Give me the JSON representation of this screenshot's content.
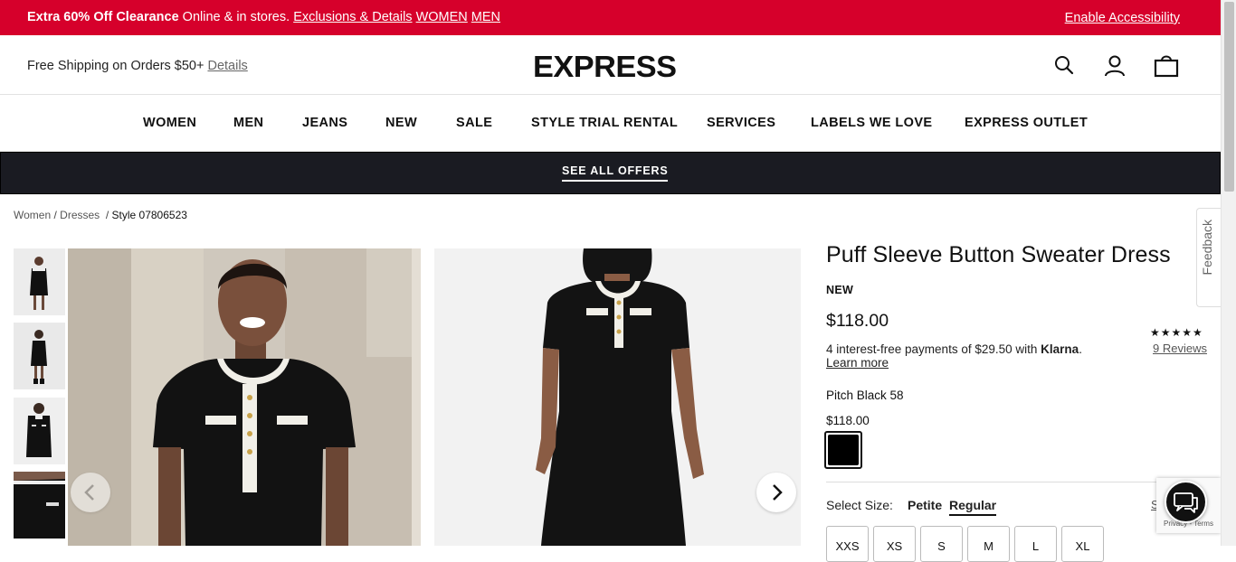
{
  "promo": {
    "bold": "Extra 60% Off Clearance",
    "text": "Online & in stores.",
    "links": [
      "Exclusions & Details",
      "WOMEN",
      "MEN"
    ],
    "accessibility": "Enable Accessibility"
  },
  "header": {
    "shipping": "Free Shipping on Orders $50+",
    "details": "Details",
    "logo": "EXPRESS"
  },
  "nav": [
    "WOMEN",
    "MEN",
    "JEANS",
    "NEW",
    "SALE",
    "STYLE TRIAL RENTAL",
    "SERVICES",
    "LABELS WE LOVE",
    "EXPRESS OUTLET"
  ],
  "offers": "SEE ALL OFFERS",
  "breadcrumb": {
    "women": "Women",
    "dresses": "Dresses",
    "style": "Style 07806523"
  },
  "product": {
    "title": "Puff Sleeve Button Sweater Dress",
    "badge": "NEW",
    "price": "$118.00",
    "klarna_pre": "4 interest-free payments of $29.50 with",
    "klarna_brand": "Klarna",
    "klarna_post": ".",
    "learn_more": "Learn more",
    "stars": "★★★★★",
    "rating": 5,
    "reviews": "9 Reviews",
    "color_name": "Pitch Black 58",
    "color_price": "$118.00",
    "swatch_color": "#000000",
    "size_label": "Select Size:",
    "fits": [
      "Petite",
      "Regular"
    ],
    "selected_fit": "Regular",
    "size_chart": "S",
    "sizes": [
      "XXS",
      "XS",
      "S",
      "M",
      "L",
      "XL"
    ]
  },
  "feedback": "Feedback",
  "recaptcha": "Privacy - Terms"
}
